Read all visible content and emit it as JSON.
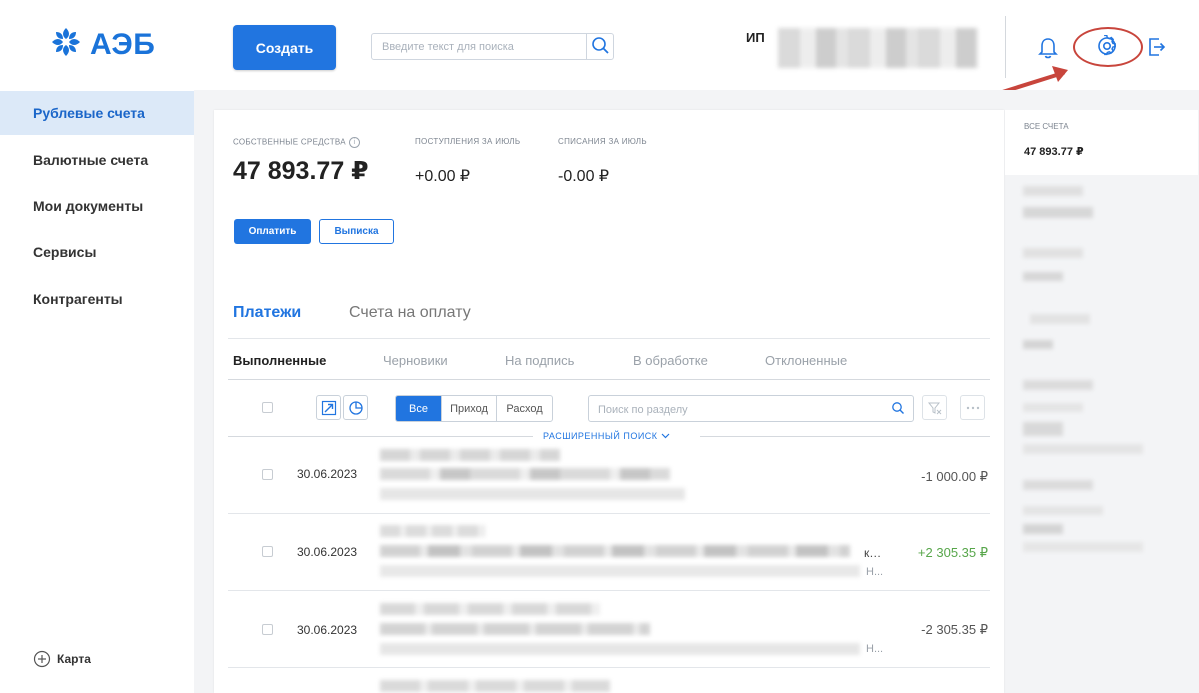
{
  "header": {
    "logo_text": "АЭБ",
    "create_label": "Создать",
    "search_placeholder": "Введите текст для поиска",
    "user_prefix": "ИП"
  },
  "sidebar": {
    "items": [
      {
        "label": "Рублевые счета",
        "active": true
      },
      {
        "label": "Валютные счета",
        "active": false
      },
      {
        "label": "Мои документы",
        "active": false
      },
      {
        "label": "Сервисы",
        "active": false
      },
      {
        "label": "Контрагенты",
        "active": false
      }
    ],
    "map_label": "Карта"
  },
  "balance": {
    "own_funds_label": "СОБСТВЕННЫЕ СРЕДСТВА",
    "own_funds_value": "47 893.77 ₽",
    "income_label": "ПОСТУПЛЕНИЯ ЗА ИЮЛЬ",
    "income_value": "+0.00 ₽",
    "expense_label": "СПИСАНИЯ ЗА ИЮЛЬ",
    "expense_value": "-0.00 ₽",
    "pay_label": "Оплатить",
    "statement_label": "Выписка"
  },
  "tabs": {
    "payments": "Платежи",
    "invoices": "Счета на оплату"
  },
  "subtabs": [
    {
      "label": "Выполненные",
      "active": true
    },
    {
      "label": "Черновики",
      "active": false
    },
    {
      "label": "На подпись",
      "active": false
    },
    {
      "label": "В обработке",
      "active": false
    },
    {
      "label": "Отклоненные",
      "active": false
    }
  ],
  "filters": {
    "all": "Все",
    "income": "Приход",
    "expense": "Расход",
    "search_placeholder": "Поиск по разделу",
    "advanced_search": "РАСШИРЕННЫЙ ПОИСК"
  },
  "payments": [
    {
      "date": "30.06.2023",
      "amount": "-1 000.00 ₽",
      "type": "neg"
    },
    {
      "date": "30.06.2023",
      "amount": "+2 305.35 ₽",
      "type": "pos",
      "trunc1": "к…",
      "trunc2": "Н..."
    },
    {
      "date": "30.06.2023",
      "amount": "-2 305.35 ₽",
      "type": "neg",
      "trunc2": "Н..."
    }
  ],
  "right_panel": {
    "all_accounts_label": "ВСЕ СЧЕТА",
    "all_accounts_value": "47 893.77 ₽"
  },
  "colors": {
    "accent": "#2175e0",
    "positive": "#57a64a",
    "annotation": "#c8453c"
  }
}
